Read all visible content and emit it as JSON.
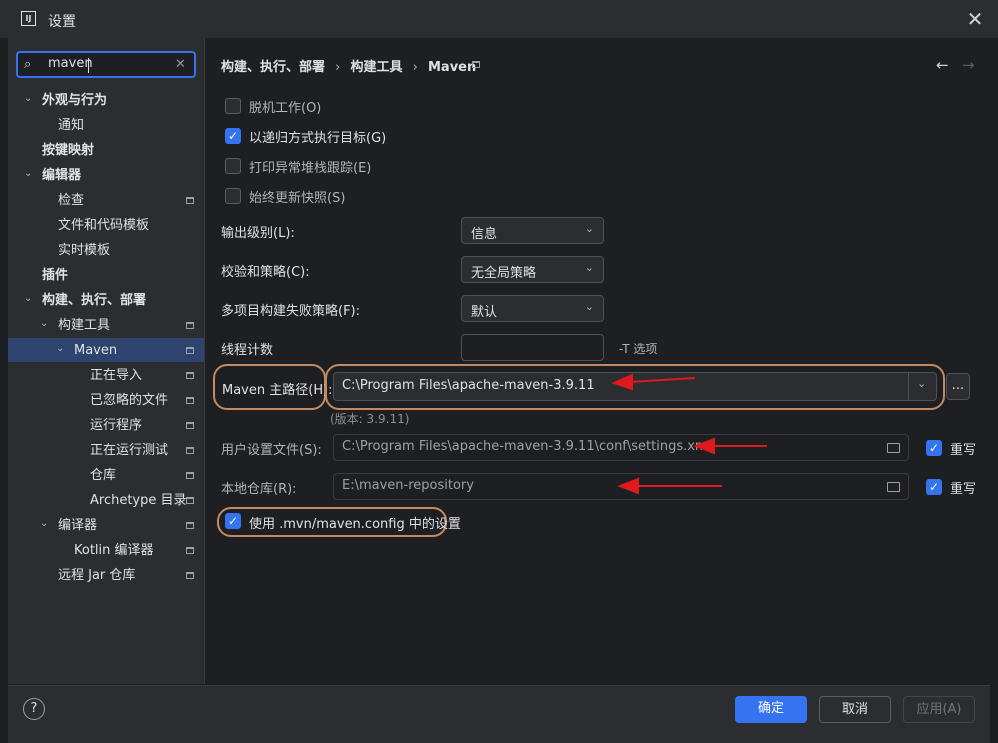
{
  "window": {
    "title": "设置",
    "logo": "IJ"
  },
  "search": {
    "value": "maven"
  },
  "tree": [
    {
      "label": "外观与行为",
      "bold": true,
      "chev": "⌄"
    },
    {
      "label": "通知"
    },
    {
      "label": "按键映射",
      "bold": true
    },
    {
      "label": "编辑器",
      "bold": true,
      "chev": "⌄"
    },
    {
      "label": "检查"
    },
    {
      "label": "文件和代码模板"
    },
    {
      "label": "实时模板"
    },
    {
      "label": "插件",
      "bold": true
    },
    {
      "label": "构建、执行、部署",
      "bold": true,
      "chev": "⌄"
    },
    {
      "label": "构建工具",
      "chev": "⌄"
    },
    {
      "label": "Maven",
      "chev": "⌄"
    },
    {
      "label": "正在导入"
    },
    {
      "label": "已忽略的文件"
    },
    {
      "label": "运行程序"
    },
    {
      "label": "正在运行测试"
    },
    {
      "label": "仓库"
    },
    {
      "label": "Archetype 目录"
    },
    {
      "label": "编译器",
      "chev": "⌄"
    },
    {
      "label": "Kotlin 编译器"
    },
    {
      "label": "远程 Jar 仓库"
    }
  ],
  "breadcrumb": {
    "part1": "构建、执行、部署",
    "sep": "›",
    "part2": "构建工具",
    "part3": "Maven"
  },
  "checkboxes": [
    {
      "label": "脱机工作(O)",
      "checked": false
    },
    {
      "label": "以递归方式执行目标(G)",
      "checked": true
    },
    {
      "label": "打印异常堆栈跟踪(E)",
      "checked": false
    },
    {
      "label": "始终更新快照(S)",
      "checked": false
    }
  ],
  "settings": {
    "output_level_label": "输出级别(L):",
    "output_level_value": "信息",
    "checksum_label": "校验和策略(C):",
    "checksum_value": "无全局策略",
    "multiproject_label": "多项目构建失败策略(F):",
    "multiproject_value": "默认",
    "threads_label": "线程计数",
    "threads_value": "",
    "threads_hint": "-T 选项",
    "maven_home_label": "Maven 主路径(H):",
    "maven_home_value": "C:\\Program Files\\apache-maven-3.9.11",
    "version": "(版本: 3.9.11)",
    "user_settings_label": "用户设置文件(S):",
    "user_settings_value": "C:\\Program Files\\apache-maven-3.9.11\\conf\\settings.xml",
    "local_repo_label": "本地仓库(R):",
    "local_repo_value": "E:\\maven-repository",
    "override_label": "重写",
    "mvn_config_label": "使用 .mvn/maven.config 中的设置",
    "more_button": "..."
  },
  "footer": {
    "help": "?",
    "ok": "确定",
    "cancel": "取消",
    "apply": "应用(A)"
  },
  "colors": {
    "accent": "#3574f0",
    "annotation": "#c28a61",
    "arrow": "#e0191c"
  }
}
